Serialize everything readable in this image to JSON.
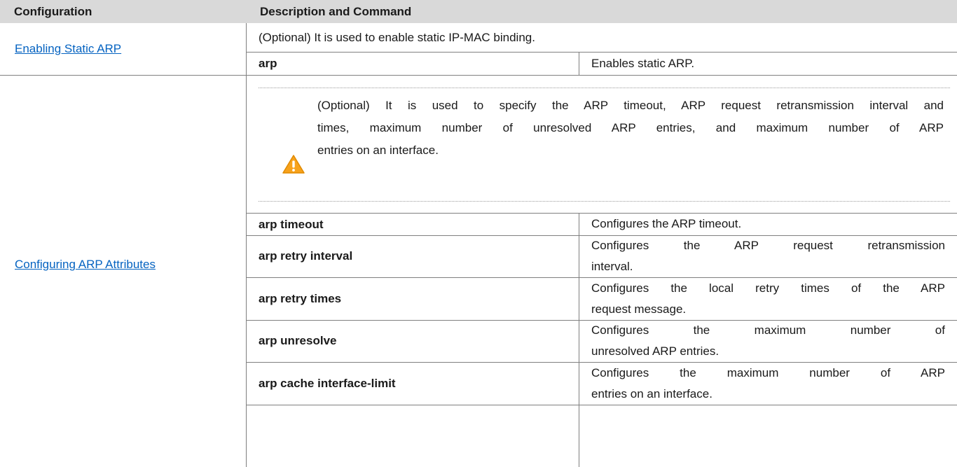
{
  "table": {
    "headers": [
      "Configuration",
      "Description and Command"
    ],
    "rows": [
      {
        "configuration": "Enabling Static ARP",
        "note": "(Optional) It is used to enable static IP-MAC binding.",
        "commands": [
          {
            "command": "arp",
            "description": "Enables static ARP."
          }
        ]
      },
      {
        "configuration": "Configuring ARP Attributes",
        "note_lines": [
          "(Optional) It is used to specify the ARP timeout, ARP request retransmission interval and",
          "times, maximum number of unresolved ARP entries, and maximum number of ARP",
          "entries on an interface."
        ],
        "note_icon": "warning-triangle-icon",
        "commands": [
          {
            "command": "arp timeout",
            "description_lines": [
              "Configures the ARP timeout."
            ]
          },
          {
            "command": "arp retry interval",
            "description_lines": [
              "Configures the ARP request retransmission",
              "interval."
            ]
          },
          {
            "command": "arp retry times",
            "description_lines": [
              "Configures the local retry times of the ARP",
              "request message."
            ]
          },
          {
            "command": "arp unresolve",
            "description_lines": [
              "Configures the maximum number of",
              "unresolved ARP entries."
            ]
          },
          {
            "command": "arp cache interface-limit",
            "description_lines": [
              "Configures the maximum number of ARP",
              "entries on an interface."
            ]
          }
        ]
      }
    ]
  },
  "colors": {
    "header_bg": "#d9d9d9",
    "link": "#0563c1",
    "warning": "#f7a21b"
  }
}
